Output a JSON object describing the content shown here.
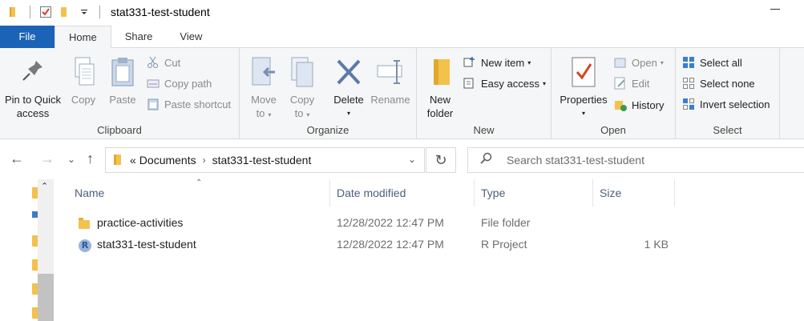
{
  "window": {
    "title": "stat331-test-student"
  },
  "tabs": [
    {
      "label": "File"
    },
    {
      "label": "Home"
    },
    {
      "label": "Share"
    },
    {
      "label": "View"
    }
  ],
  "ribbon": {
    "clipboard": {
      "label": "Clipboard",
      "pin": "Pin to Quick access",
      "pin_l1": "Pin to Quick",
      "pin_l2": "access",
      "copy": "Copy",
      "paste": "Paste",
      "cut": "Cut",
      "copy_path": "Copy path",
      "paste_shortcut": "Paste shortcut"
    },
    "organize": {
      "label": "Organize",
      "move_to_l1": "Move",
      "move_to_l2": "to",
      "copy_to_l1": "Copy",
      "copy_to_l2": "to",
      "delete": "Delete",
      "rename": "Rename"
    },
    "new": {
      "label": "New",
      "new_folder_l1": "New",
      "new_folder_l2": "folder",
      "new_item": "New item",
      "easy_access": "Easy access"
    },
    "open": {
      "label": "Open",
      "properties": "Properties",
      "open": "Open",
      "edit": "Edit",
      "history": "History"
    },
    "select": {
      "label": "Select",
      "select_all": "Select all",
      "select_none": "Select none",
      "invert_selection": "Invert selection"
    }
  },
  "address": {
    "overflow": "«",
    "crumbs": [
      "Documents",
      "stat331-test-student"
    ]
  },
  "search": {
    "placeholder": "Search stat331-test-student"
  },
  "columns": {
    "name": "Name",
    "date_modified": "Date modified",
    "type": "Type",
    "size": "Size"
  },
  "files": [
    {
      "name": "practice-activities",
      "date": "12/28/2022 12:47 PM",
      "type": "File folder",
      "size": "",
      "icon": "folder-icon"
    },
    {
      "name": "stat331-test-student",
      "date": "12/28/2022 12:47 PM",
      "type": "R Project",
      "size": "1 KB",
      "icon": "rproj-icon"
    }
  ],
  "icons": {
    "rproj_letter": "R"
  },
  "colors": {
    "file_tab": "#1a63b7",
    "folder": "#f3c24d",
    "ribbon_bg": "#f5f6f7",
    "column_header_text": "#4c607a"
  }
}
